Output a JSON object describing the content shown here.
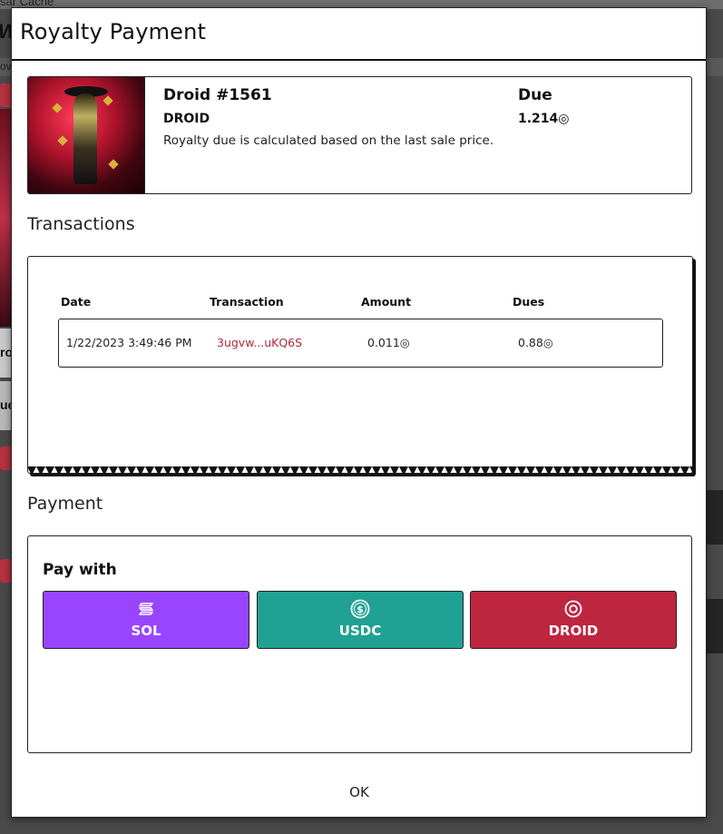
{
  "background": {
    "breadcrumb": "sar Cache",
    "title": "Wa",
    "strip_text": "ov",
    "card1_text": "ro",
    "card2_text": "ue"
  },
  "modal": {
    "title": "Royalty Payment"
  },
  "item": {
    "name": "Droid #1561",
    "symbol": "DROID",
    "description": "Royalty due is calculated based on the last sale price.",
    "due_label": "Due",
    "due_value": "1.214◎"
  },
  "transactions": {
    "section_title": "Transactions",
    "columns": [
      "Date",
      "Transaction",
      "Amount",
      "Dues"
    ],
    "rows": [
      {
        "date": "1/22/2023 3:49:46 PM",
        "transaction": "3ugvw...uKQ6S",
        "amount": "0.011◎",
        "dues": "0.88◎"
      }
    ]
  },
  "payment": {
    "section_title": "Payment",
    "pay_with_label": "Pay with",
    "options": [
      {
        "label": "SOL",
        "icon": "solana-icon",
        "color": "#9945ff"
      },
      {
        "label": "USDC",
        "icon": "usdc-dollar-icon",
        "color": "#20a193"
      },
      {
        "label": "DROID",
        "icon": "droid-token-icon",
        "color": "#be2640"
      }
    ]
  },
  "footer": {
    "ok_label": "OK"
  }
}
